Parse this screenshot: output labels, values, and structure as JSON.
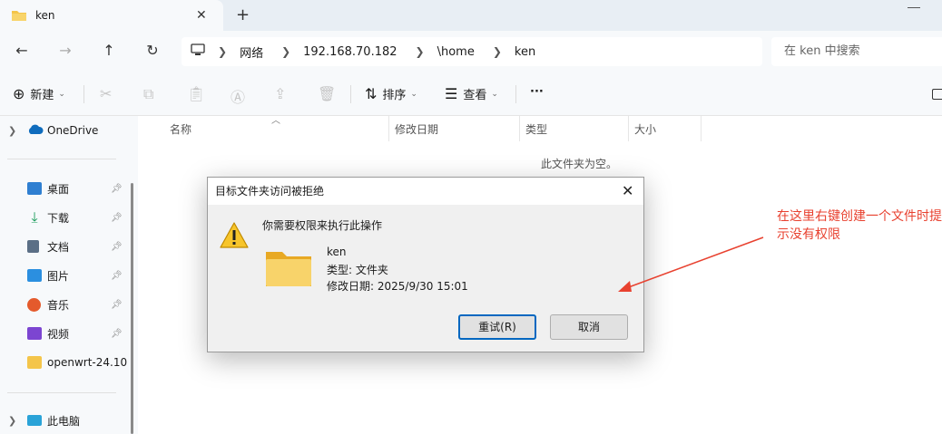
{
  "tab": {
    "title": "ken",
    "close": "✕",
    "new_tab": "+"
  },
  "nav": {
    "back": "←",
    "forward": "→",
    "up": "↑",
    "refresh": "↻"
  },
  "address": {
    "segments": [
      "网络",
      "192.168.70.182",
      "\\home",
      "ken"
    ]
  },
  "search": {
    "placeholder": "在 ken 中搜索"
  },
  "toolbar": {
    "new_label": "新建",
    "sort_label": "排序",
    "view_label": "查看",
    "more": "···"
  },
  "sidebar": {
    "onedrive": "OneDrive",
    "items": [
      {
        "label": "桌面",
        "icon": "desktop-icon",
        "color": "#2f7fd1"
      },
      {
        "label": "下载",
        "icon": "download-icon",
        "color": "#1a9c5a"
      },
      {
        "label": "文档",
        "icon": "document-icon",
        "color": "#5b6f86"
      },
      {
        "label": "图片",
        "icon": "pictures-icon",
        "color": "#2b8fe0"
      },
      {
        "label": "音乐",
        "icon": "music-icon",
        "color": "#e45a2c"
      },
      {
        "label": "视频",
        "icon": "video-icon",
        "color": "#7c45d1"
      },
      {
        "label": "openwrt-24.10",
        "icon": "folder-icon",
        "color": "#f4c54a"
      }
    ],
    "this_pc": "此电脑"
  },
  "columns": [
    "名称",
    "修改日期",
    "类型",
    "大小"
  ],
  "empty_text": "此文件夹为空。",
  "dialog": {
    "title": "目标文件夹访问被拒绝",
    "message": "你需要权限来执行此操作",
    "folder_name": "ken",
    "type_line": "类型: 文件夹",
    "date_line": "修改日期: 2025/9/30 15:01",
    "retry": "重试(R)",
    "cancel": "取消"
  },
  "annotation": {
    "text": "在这里右键创建一个文件时提示没有权限",
    "color": "#e8412f"
  }
}
